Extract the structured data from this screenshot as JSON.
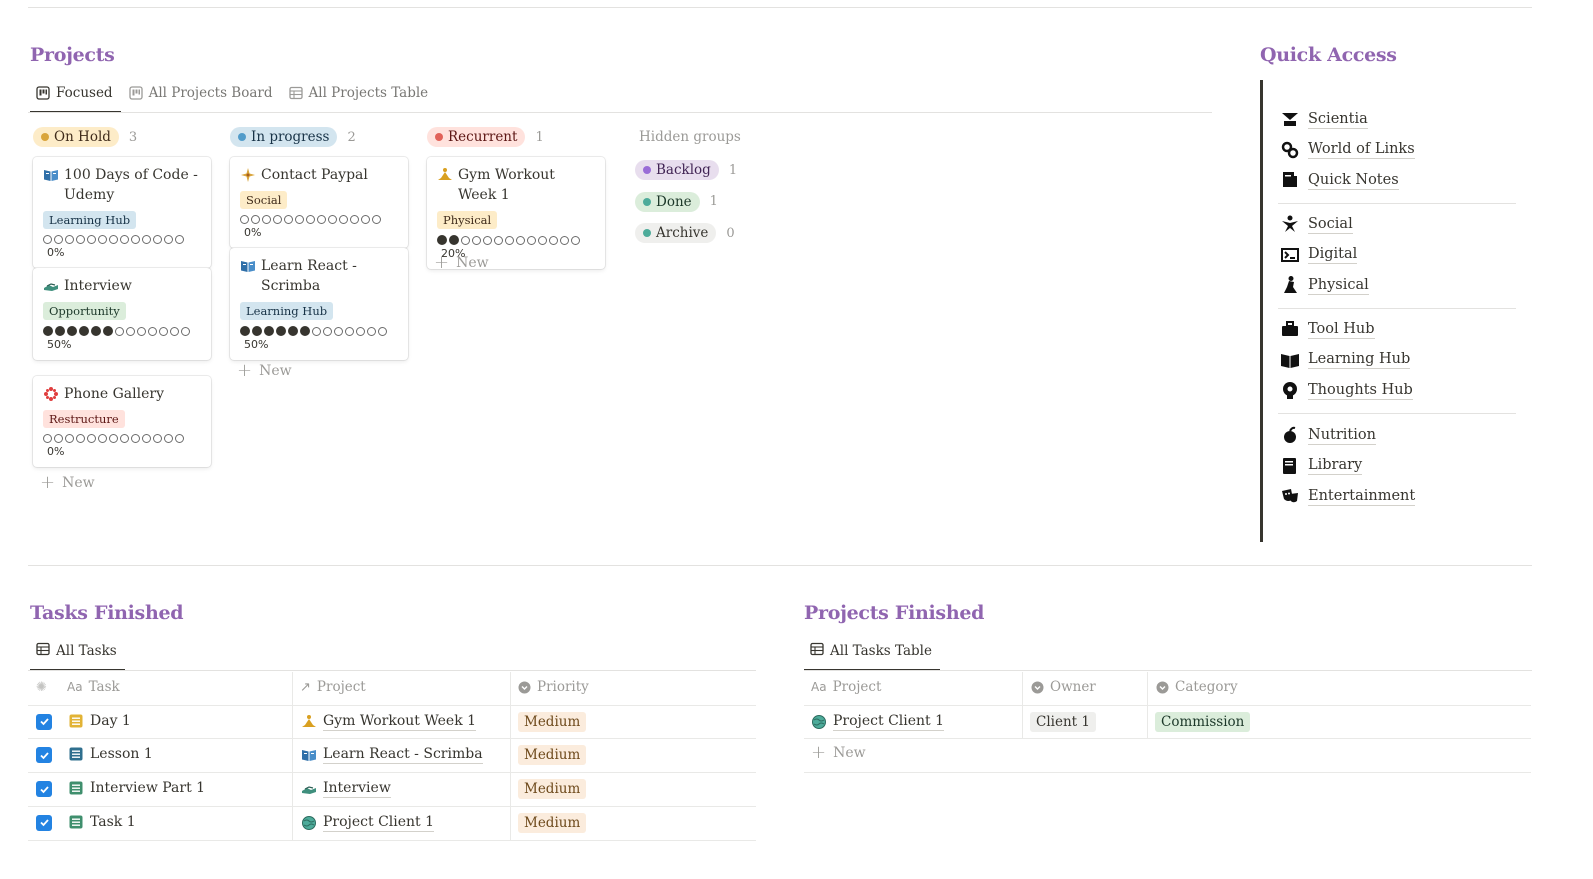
{
  "colors": {
    "accent": "#9065b0",
    "checkbox": "#2383e2"
  },
  "projects": {
    "title": "Projects",
    "tabs": [
      {
        "label": "Focused",
        "icon": "board-icon"
      },
      {
        "label": "All Projects Board",
        "icon": "board-icon"
      },
      {
        "label": "All Projects Table",
        "icon": "table-icon"
      }
    ],
    "groups": [
      {
        "label": "On Hold",
        "count": "3",
        "dot": "#d9a53c",
        "bg": "#fdecc8",
        "fg": "#402c1b",
        "cards": [
          {
            "title": "100 Days of Code - Udemy",
            "icon": "book-icon",
            "tag": "Learning Hub",
            "tag_bg": "#d3e5ef",
            "tag_fg": "#183347",
            "filled": 0,
            "total": 13,
            "percent": "0%"
          },
          {
            "title": "Interview",
            "icon": "handshake-icon",
            "tag": "Opportunity",
            "tag_bg": "#dbeddb",
            "tag_fg": "#1c3829",
            "filled": 6,
            "total": 13,
            "percent": "50%"
          },
          {
            "title": "Phone Gallery",
            "icon": "flower-icon",
            "tag": "Restructure",
            "tag_bg": "#ffe2dd",
            "tag_fg": "#5d1715",
            "filled": 0,
            "total": 13,
            "percent": "0%"
          }
        ],
        "new_label": "New"
      },
      {
        "label": "In progress",
        "count": "2",
        "dot": "#529cca",
        "bg": "#d3e5ef",
        "fg": "#183347",
        "cards": [
          {
            "title": "Contact Paypal",
            "icon": "sparkle-icon",
            "tag": "Social",
            "tag_bg": "#fdecc8",
            "tag_fg": "#402c1b",
            "filled": 0,
            "total": 13,
            "percent": "0%"
          },
          {
            "title": "Learn React - Scrimba",
            "icon": "book-icon",
            "tag": "Learning Hub",
            "tag_bg": "#d3e5ef",
            "tag_fg": "#183347",
            "filled": 6,
            "total": 13,
            "percent": "50%"
          }
        ],
        "new_label": "New"
      },
      {
        "label": "Recurrent",
        "count": "1",
        "dot": "#e16259",
        "bg": "#ffe2dd",
        "fg": "#5d1715",
        "cards": [
          {
            "title": "Gym Workout Week 1",
            "icon": "meditation-icon",
            "tag": "Physical",
            "tag_bg": "#fdecc8",
            "tag_fg": "#402c1b",
            "filled": 2,
            "total": 13,
            "percent": "20%"
          }
        ],
        "new_label": "New"
      }
    ],
    "hidden_groups_title": "Hidden groups",
    "hidden_groups": [
      {
        "label": "Backlog",
        "count": "1",
        "dot": "#9a6dd7",
        "bg": "#e8deee",
        "fg": "#412454"
      },
      {
        "label": "Done",
        "count": "1",
        "dot": "#4dab9a",
        "bg": "#dbeddb",
        "fg": "#1c3829"
      },
      {
        "label": "Archive",
        "count": "0",
        "dot": "#4dab9a",
        "bg": "#efefed",
        "fg": "#37352f"
      }
    ]
  },
  "quick_access": {
    "title": "Quick Access",
    "groups": [
      [
        {
          "label": "Scientia",
          "icon": "scientia-icon"
        },
        {
          "label": "World of Links",
          "icon": "links-icon"
        },
        {
          "label": "Quick Notes",
          "icon": "notes-icon"
        }
      ],
      [
        {
          "label": "Social",
          "icon": "social-icon"
        },
        {
          "label": "Digital",
          "icon": "digital-icon"
        },
        {
          "label": "Physical",
          "icon": "physical-icon"
        }
      ],
      [
        {
          "label": "Tool Hub",
          "icon": "toolbox-icon"
        },
        {
          "label": "Learning Hub",
          "icon": "learning-icon"
        },
        {
          "label": "Thoughts Hub",
          "icon": "thoughts-icon"
        }
      ],
      [
        {
          "label": "Nutrition",
          "icon": "nutrition-icon"
        },
        {
          "label": "Library",
          "icon": "library-icon"
        },
        {
          "label": "Entertainment",
          "icon": "entertainment-icon"
        }
      ]
    ]
  },
  "tasks_finished": {
    "title": "Tasks Finished",
    "tab": "All Tasks",
    "headers": [
      "Task",
      "Project",
      "Priority"
    ],
    "rows": [
      {
        "task": "Day 1",
        "task_icon": "yellow-list-icon",
        "project": "Gym Workout Week 1",
        "project_icon": "meditation-icon",
        "priority": "Medium"
      },
      {
        "task": "Lesson 1",
        "task_icon": "blue-list-icon",
        "project": "Learn React - Scrimba",
        "project_icon": "book-icon",
        "priority": "Medium"
      },
      {
        "task": "Interview Part 1",
        "task_icon": "green-list-icon",
        "project": "Interview",
        "project_icon": "handshake-icon",
        "priority": "Medium"
      },
      {
        "task": "Task 1",
        "task_icon": "green-list-icon",
        "project": "Project Client 1",
        "project_icon": "globe-icon",
        "priority": "Medium"
      }
    ]
  },
  "projects_finished": {
    "title": "Projects Finished",
    "tab": "All Tasks Table",
    "headers": [
      "Project",
      "Owner",
      "Category"
    ],
    "rows": [
      {
        "project": "Project Client 1",
        "owner": "Client 1",
        "category": "Commission"
      }
    ],
    "new_label": "New"
  }
}
